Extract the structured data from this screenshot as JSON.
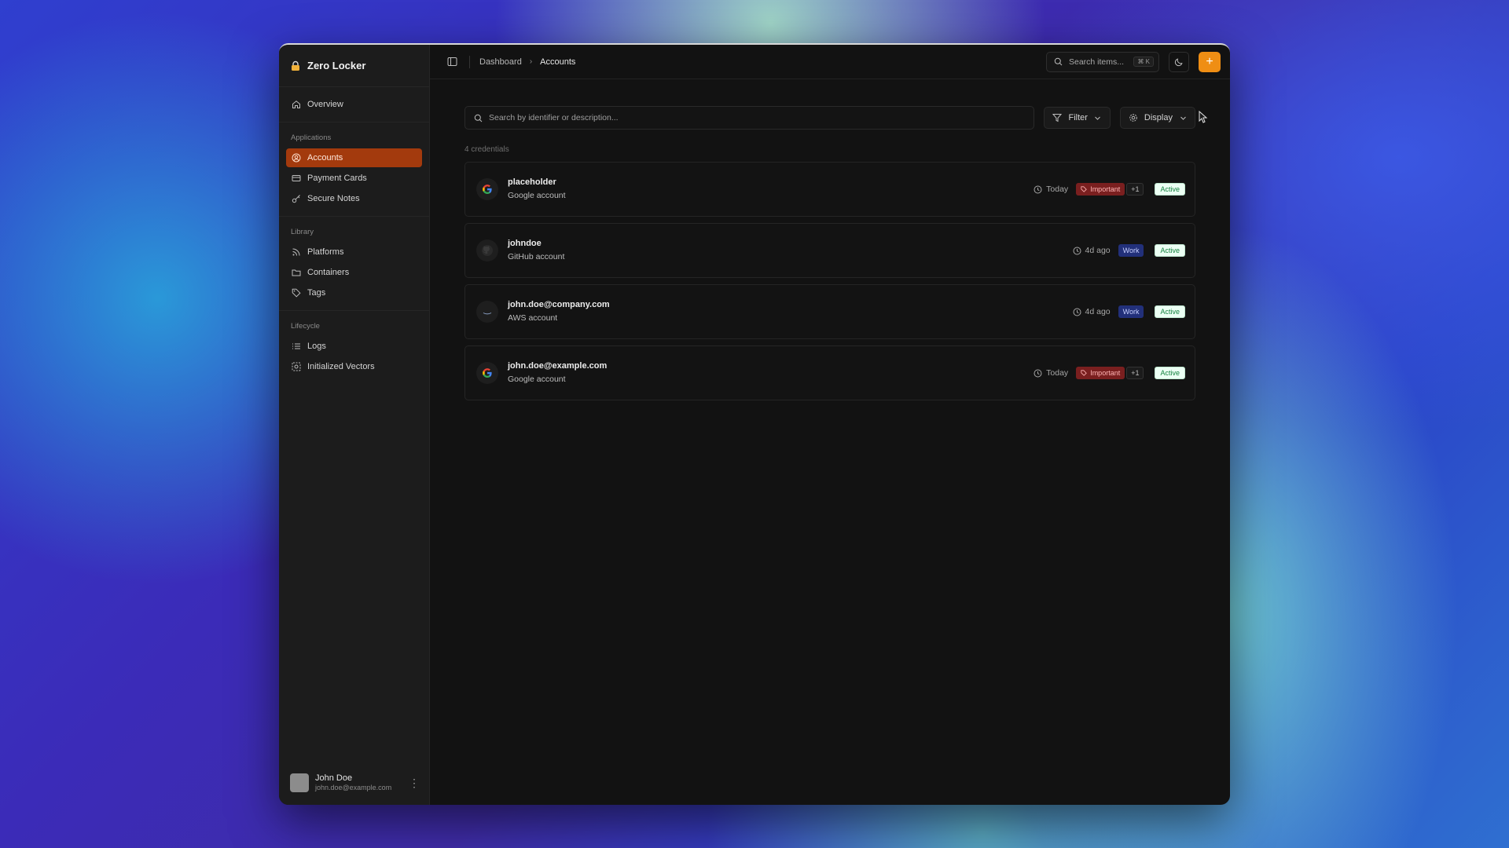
{
  "app": {
    "title": "Zero Locker"
  },
  "sidebar": {
    "overview_label": "Overview",
    "sections": [
      {
        "label": "Applications",
        "items": [
          {
            "label": "Accounts",
            "icon": "user-circle-icon",
            "active": true
          },
          {
            "label": "Payment Cards",
            "icon": "credit-card-icon"
          },
          {
            "label": "Secure Notes",
            "icon": "key-icon"
          }
        ]
      },
      {
        "label": "Library",
        "items": [
          {
            "label": "Platforms",
            "icon": "rss-icon"
          },
          {
            "label": "Containers",
            "icon": "folder-icon"
          },
          {
            "label": "Tags",
            "icon": "tag-icon"
          }
        ]
      },
      {
        "label": "Lifecycle",
        "items": [
          {
            "label": "Logs",
            "icon": "list-icon"
          },
          {
            "label": "Initialized Vectors",
            "icon": "vector-icon"
          }
        ]
      }
    ],
    "user": {
      "name": "John Doe",
      "email": "john.doe@example.com"
    }
  },
  "header": {
    "breadcrumb": [
      "Dashboard",
      "Accounts"
    ],
    "search_placeholder": "Search items...",
    "search_shortcut": "⌘ K",
    "add_label": "+"
  },
  "main": {
    "search_placeholder": "Search by identifier or description...",
    "filter_label": "Filter",
    "display_label": "Display",
    "count_text": "4 credentials",
    "credentials": [
      {
        "identifier": "placeholder",
        "description": "Google account",
        "logo": "google-icon",
        "time": "Today",
        "tag": "Important",
        "tag_extra": "+1",
        "status": "Active"
      },
      {
        "identifier": "johndoe",
        "description": "GitHub account",
        "logo": "github-icon",
        "time": "4d ago",
        "tag": "Work",
        "status": "Active"
      },
      {
        "identifier": "john.doe@company.com",
        "description": "AWS account",
        "logo": "aws-icon",
        "time": "4d ago",
        "tag": "Work",
        "status": "Active"
      },
      {
        "identifier": "john.doe@example.com",
        "description": "Google account",
        "logo": "google-icon",
        "time": "Today",
        "tag": "Important",
        "tag_extra": "+1",
        "status": "Active"
      }
    ]
  },
  "colors": {
    "accent": "#ef8e14",
    "active_nav": "#a33a0d",
    "important": "#7a1f1f",
    "work": "#22307a",
    "status_active": "#14813f"
  }
}
